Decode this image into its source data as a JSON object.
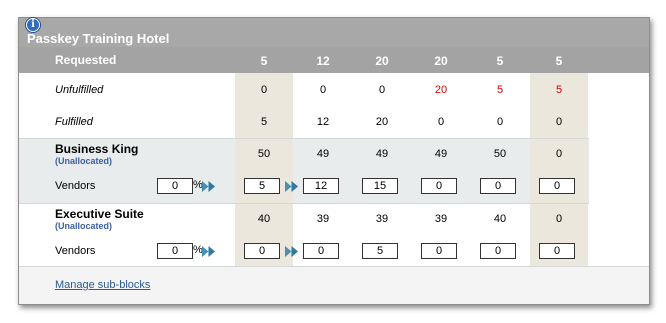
{
  "header": {
    "title": "Passkey Training Hotel",
    "info_icon": "info-icon"
  },
  "requested": {
    "label": "Requested",
    "values": [
      "5",
      "12",
      "20",
      "20",
      "5",
      "5"
    ]
  },
  "unfulfilled": {
    "label": "Unfulfilled",
    "values": [
      "0",
      "0",
      "0",
      "20",
      "5",
      "5"
    ],
    "alert_color": "#e00000"
  },
  "fulfilled": {
    "label": "Fulfilled",
    "values": [
      "5",
      "12",
      "20",
      "0",
      "0",
      "0"
    ]
  },
  "groups": [
    {
      "name": "Business King",
      "sub": "(Unallocated)",
      "unallocated": [
        "50",
        "49",
        "49",
        "49",
        "50",
        "0"
      ],
      "vendors_label": "Vendors",
      "percent": "0",
      "percent_sign": "%",
      "vendor_inputs": [
        "5",
        "12",
        "15",
        "0",
        "0",
        "0"
      ]
    },
    {
      "name": "Executive Suite",
      "sub": "(Unallocated)",
      "unallocated": [
        "40",
        "39",
        "39",
        "39",
        "40",
        "0"
      ],
      "vendors_label": "Vendors",
      "percent": "0",
      "percent_sign": "%",
      "vendor_inputs": [
        "0",
        "0",
        "5",
        "0",
        "0",
        "0"
      ]
    }
  ],
  "footer": {
    "link": "Manage sub-blocks"
  },
  "colors": {
    "title_bar": "#a8a8a8",
    "highlight_column": "#ece7dd",
    "group_band": "#e9ecec",
    "link": "#2a5b93"
  }
}
